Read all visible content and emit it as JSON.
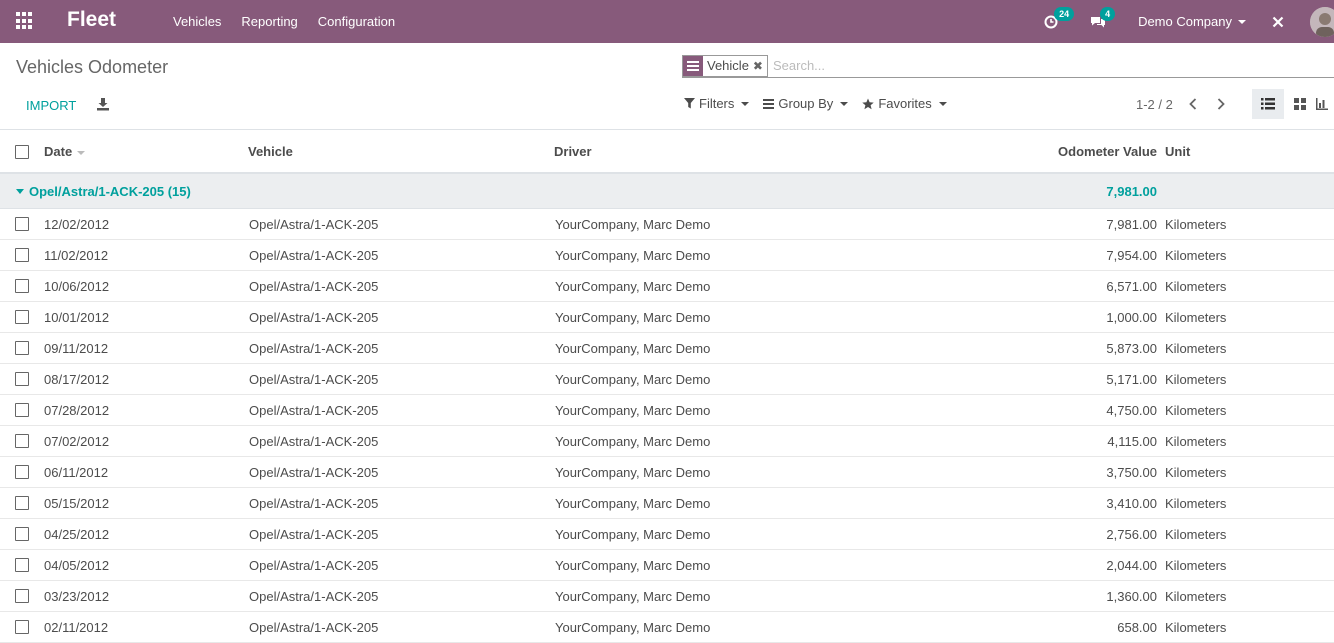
{
  "navbar": {
    "brand": "Fleet",
    "menu": [
      "Vehicles",
      "Reporting",
      "Configuration"
    ],
    "activity_count": "24",
    "message_count": "4",
    "company": "Demo Company",
    "accent": "#875a7b"
  },
  "control_panel": {
    "title": "Vehicles Odometer",
    "facet_label": "Vehicle",
    "search_placeholder": "Search...",
    "import_label": "IMPORT",
    "filters_label": "Filters",
    "groupby_label": "Group By",
    "favorites_label": "Favorites",
    "pager_value": "1-2 / 2"
  },
  "table": {
    "columns": {
      "date": "Date",
      "vehicle": "Vehicle",
      "driver": "Driver",
      "odometer": "Odometer Value",
      "unit": "Unit"
    },
    "group": {
      "label": "Opel/Astra/1-ACK-205 (15)",
      "total": "7,981.00"
    },
    "rows": [
      {
        "date": "12/02/2012",
        "vehicle": "Opel/Astra/1-ACK-205",
        "driver": "YourCompany, Marc Demo",
        "odometer": "7,981.00",
        "unit": "Kilometers"
      },
      {
        "date": "11/02/2012",
        "vehicle": "Opel/Astra/1-ACK-205",
        "driver": "YourCompany, Marc Demo",
        "odometer": "7,954.00",
        "unit": "Kilometers"
      },
      {
        "date": "10/06/2012",
        "vehicle": "Opel/Astra/1-ACK-205",
        "driver": "YourCompany, Marc Demo",
        "odometer": "6,571.00",
        "unit": "Kilometers"
      },
      {
        "date": "10/01/2012",
        "vehicle": "Opel/Astra/1-ACK-205",
        "driver": "YourCompany, Marc Demo",
        "odometer": "1,000.00",
        "unit": "Kilometers"
      },
      {
        "date": "09/11/2012",
        "vehicle": "Opel/Astra/1-ACK-205",
        "driver": "YourCompany, Marc Demo",
        "odometer": "5,873.00",
        "unit": "Kilometers"
      },
      {
        "date": "08/17/2012",
        "vehicle": "Opel/Astra/1-ACK-205",
        "driver": "YourCompany, Marc Demo",
        "odometer": "5,171.00",
        "unit": "Kilometers"
      },
      {
        "date": "07/28/2012",
        "vehicle": "Opel/Astra/1-ACK-205",
        "driver": "YourCompany, Marc Demo",
        "odometer": "4,750.00",
        "unit": "Kilometers"
      },
      {
        "date": "07/02/2012",
        "vehicle": "Opel/Astra/1-ACK-205",
        "driver": "YourCompany, Marc Demo",
        "odometer": "4,115.00",
        "unit": "Kilometers"
      },
      {
        "date": "06/11/2012",
        "vehicle": "Opel/Astra/1-ACK-205",
        "driver": "YourCompany, Marc Demo",
        "odometer": "3,750.00",
        "unit": "Kilometers"
      },
      {
        "date": "05/15/2012",
        "vehicle": "Opel/Astra/1-ACK-205",
        "driver": "YourCompany, Marc Demo",
        "odometer": "3,410.00",
        "unit": "Kilometers"
      },
      {
        "date": "04/25/2012",
        "vehicle": "Opel/Astra/1-ACK-205",
        "driver": "YourCompany, Marc Demo",
        "odometer": "2,756.00",
        "unit": "Kilometers"
      },
      {
        "date": "04/05/2012",
        "vehicle": "Opel/Astra/1-ACK-205",
        "driver": "YourCompany, Marc Demo",
        "odometer": "2,044.00",
        "unit": "Kilometers"
      },
      {
        "date": "03/23/2012",
        "vehicle": "Opel/Astra/1-ACK-205",
        "driver": "YourCompany, Marc Demo",
        "odometer": "1,360.00",
        "unit": "Kilometers"
      },
      {
        "date": "02/11/2012",
        "vehicle": "Opel/Astra/1-ACK-205",
        "driver": "YourCompany, Marc Demo",
        "odometer": "658.00",
        "unit": "Kilometers"
      }
    ]
  }
}
